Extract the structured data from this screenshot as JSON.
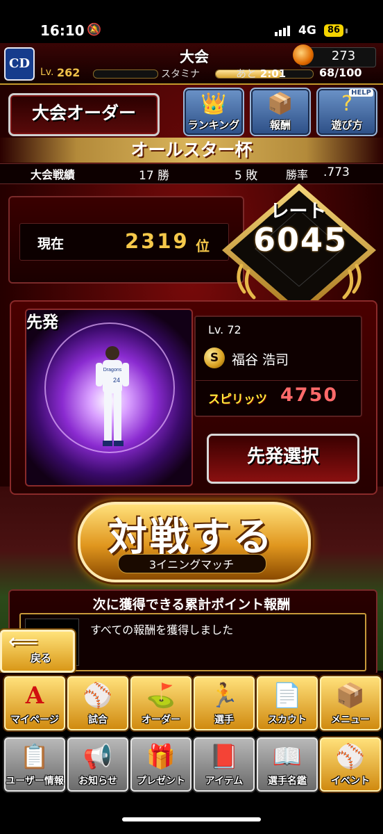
{
  "status_bar": {
    "time": "16:10",
    "network": "4G",
    "battery": "86"
  },
  "header": {
    "title": "大会",
    "team_logo": "CD",
    "currency": "273",
    "level_label": "Lv.",
    "level": "262",
    "level_progress": 0.0,
    "stamina_label": "スタミナ",
    "stamina_next_label": "あと",
    "stamina_next_time": "2:01",
    "stamina": "68/100",
    "stamina_fraction": 0.68
  },
  "top_buttons": {
    "order": "大会オーダー",
    "ranking": "ランキング",
    "reward": "報酬",
    "howto": "遊び方",
    "help_badge": "HELP"
  },
  "tournament": {
    "title": "オールスター杯"
  },
  "record": {
    "label": "大会戦績",
    "wins": "17 勝",
    "losses": "5 敗",
    "rate_label": "勝率",
    "rate": ".773"
  },
  "rank": {
    "label": "現在",
    "value": "2319",
    "unit": "位"
  },
  "rate": {
    "label": "レート",
    "value": "6045"
  },
  "starter": {
    "title": "先発",
    "level": "Lv. 72",
    "badge": "S",
    "name": "福谷 浩司",
    "spirit_label": "スピリッツ",
    "spirit_value": "4750",
    "select_button": "先発選択",
    "jersey": "24",
    "team_name": "Dragons"
  },
  "battle": {
    "main": "対戦する",
    "sub": "3イニングマッチ"
  },
  "reward": {
    "title": "次に獲得できる累計ポイント報酬",
    "text": "すべての報酬を獲得しました",
    "back_label": "戻る"
  },
  "nav_row1": [
    {
      "label": "マイページ",
      "icon": "a-letter-icon"
    },
    {
      "label": "試合",
      "icon": "stadium-icon"
    },
    {
      "label": "オーダー",
      "icon": "field-icon"
    },
    {
      "label": "選手",
      "icon": "player-icon"
    },
    {
      "label": "スカウト",
      "icon": "scout-icon"
    },
    {
      "label": "メニュー",
      "icon": "menu-icon"
    }
  ],
  "nav_row2": [
    {
      "label": "ユーザー情報",
      "icon": "user-card-icon"
    },
    {
      "label": "お知らせ",
      "icon": "notice-icon"
    },
    {
      "label": "プレゼント",
      "icon": "gift-icon"
    },
    {
      "label": "アイテム",
      "icon": "item-icon"
    },
    {
      "label": "選手名鑑",
      "icon": "player-book-icon"
    },
    {
      "label": "イベント",
      "icon": "event-icon"
    }
  ]
}
